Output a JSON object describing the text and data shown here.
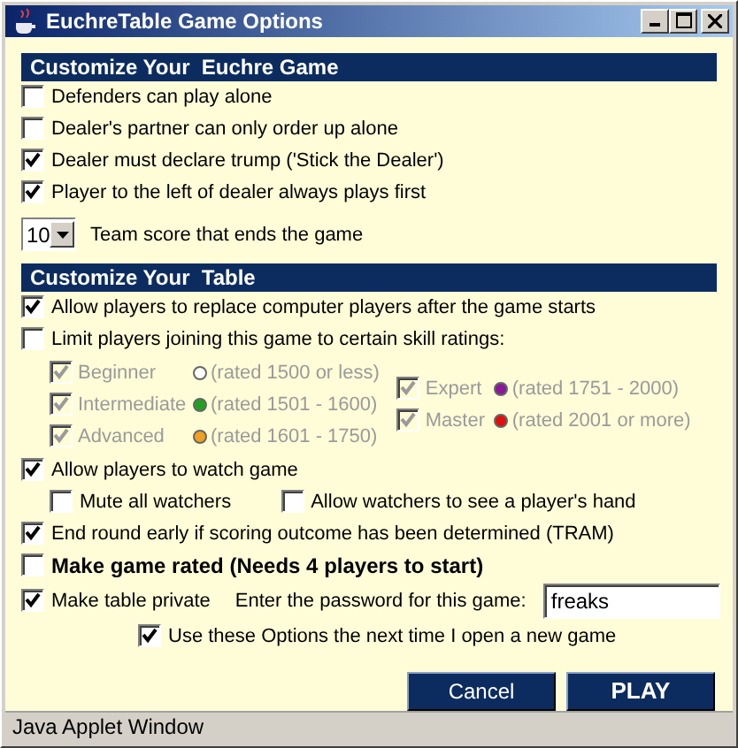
{
  "window": {
    "title": "EuchreTable Game Options"
  },
  "sections": [
    {
      "title": "Customize Your  Euchre Game",
      "items": [
        {
          "kind": "checkbox",
          "label": "Defenders can play alone",
          "checked": false
        },
        {
          "kind": "checkbox",
          "label": "Dealer's partner can only order up alone",
          "checked": false
        },
        {
          "kind": "checkbox",
          "label": "Dealer must declare trump ('Stick the Dealer')",
          "checked": true
        },
        {
          "kind": "checkbox",
          "label": "Player to the left of dealer always plays first",
          "checked": true
        },
        {
          "kind": "dropdown",
          "value": "10",
          "label": "Team score that ends the game"
        }
      ]
    },
    {
      "title": "Customize Your  Table",
      "items": [
        {
          "kind": "checkbox",
          "label": "Allow players to replace computer players after the game starts",
          "checked": true
        },
        {
          "kind": "checkbox",
          "label": "Limit players joining this game to certain skill ratings:",
          "checked": false
        },
        {
          "kind": "ratings",
          "columns": [
            [
              {
                "label": "Beginner",
                "checked": true,
                "disabled": true,
                "color": "#ffffff",
                "range": "(rated 1500 or less)"
              },
              {
                "label": "Intermediate",
                "checked": true,
                "disabled": true,
                "color": "#22a022",
                "range": "(rated 1501 - 1600)"
              },
              {
                "label": "Advanced",
                "checked": true,
                "disabled": true,
                "color": "#f0a020",
                "range": "(rated 1601 - 1750)"
              }
            ],
            [
              {
                "label": "Expert",
                "checked": true,
                "disabled": true,
                "color": "#8a1a9a",
                "range": "(rated 1751 - 2000)"
              },
              {
                "label": "Master",
                "checked": true,
                "disabled": true,
                "color": "#e01010",
                "range": "(rated 2001 or more)"
              }
            ]
          ]
        },
        {
          "kind": "checkbox",
          "label": "Allow players to watch game",
          "checked": true
        },
        {
          "kind": "pair",
          "items": [
            {
              "label": "Mute all watchers",
              "checked": false
            },
            {
              "label": "Allow watchers to see a player's hand",
              "checked": false
            }
          ]
        },
        {
          "kind": "checkbox",
          "label": "End round early if scoring outcome has been determined (TRAM)",
          "checked": true
        },
        {
          "kind": "checkbox",
          "label": "Make game rated (Needs 4 players to start)",
          "checked": false,
          "bold": true
        },
        {
          "kind": "password",
          "label": "Make table private",
          "checked": true,
          "prompt": "Enter the password for this game:",
          "value": "freaks"
        },
        {
          "kind": "footer",
          "label": "Use these Options the next time I open a new game",
          "checked": true
        }
      ]
    }
  ],
  "buttons": [
    {
      "label": "Cancel",
      "kind": "secondary"
    },
    {
      "label": "PLAY",
      "kind": "primary"
    }
  ],
  "status_bar": "Java Applet Window"
}
